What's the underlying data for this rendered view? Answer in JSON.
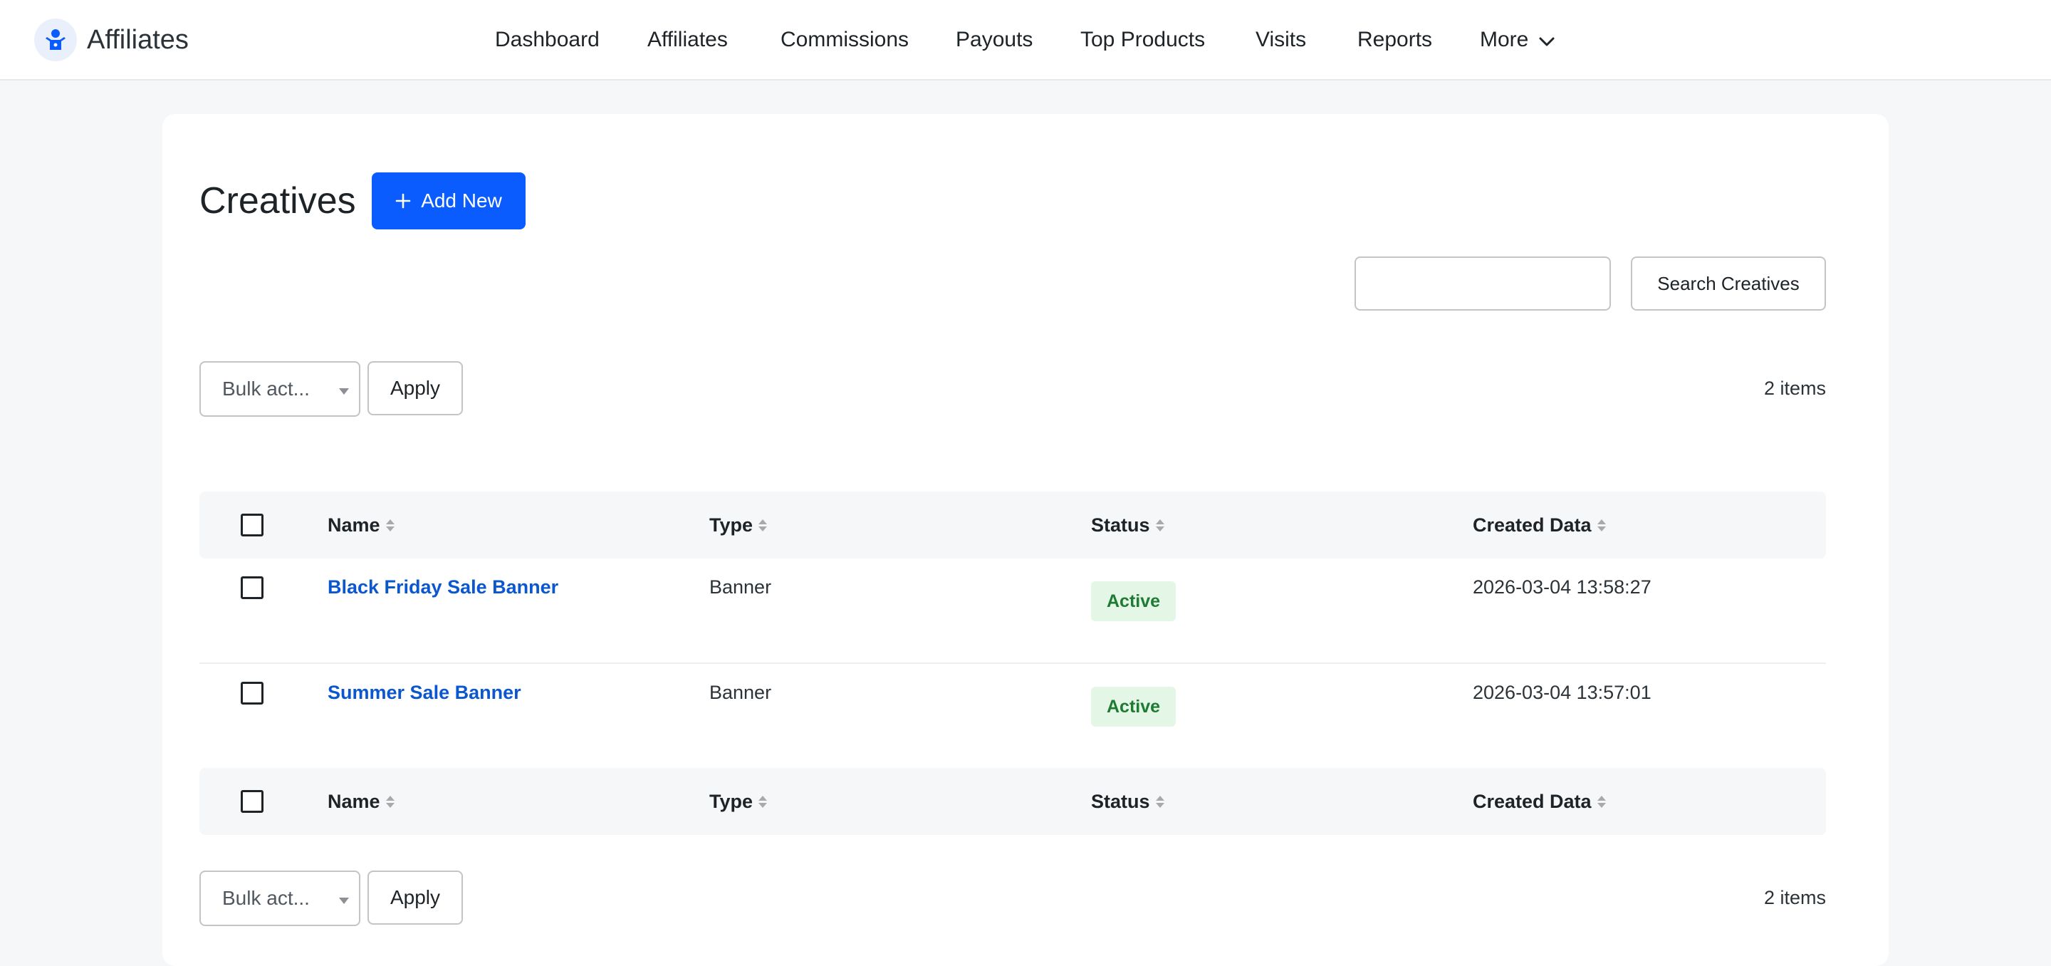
{
  "app": {
    "brand_name": "Affiliates",
    "logo_icon": "affiliates-logo-icon",
    "accent_color": "#0b5cff"
  },
  "nav": {
    "items": [
      "Dashboard",
      "Affiliates",
      "Commissions",
      "Payouts",
      "Top Products",
      "Visits",
      "Reports"
    ],
    "more_label": "More"
  },
  "page": {
    "title": "Creatives",
    "add_new_label": "Add New",
    "search_value": "",
    "search_button_label": "Search Creatives"
  },
  "bulk_top": {
    "select_value": "Bulk act...",
    "apply_label": "Apply",
    "items_count": "2 items"
  },
  "bulk_bottom": {
    "select_value": "Bulk act...",
    "apply_label": "Apply",
    "items_count": "2 items"
  },
  "table": {
    "columns": [
      "Name",
      "Type",
      "Status",
      "Created Data"
    ],
    "rows": [
      {
        "name": "Black Friday Sale Banner",
        "type": "Banner",
        "status": "Active",
        "created": "2026-03-04 13:58:27"
      },
      {
        "name": "Summer Sale Banner",
        "type": "Banner",
        "status": "Active",
        "created": "2026-03-04 13:57:01"
      }
    ]
  }
}
